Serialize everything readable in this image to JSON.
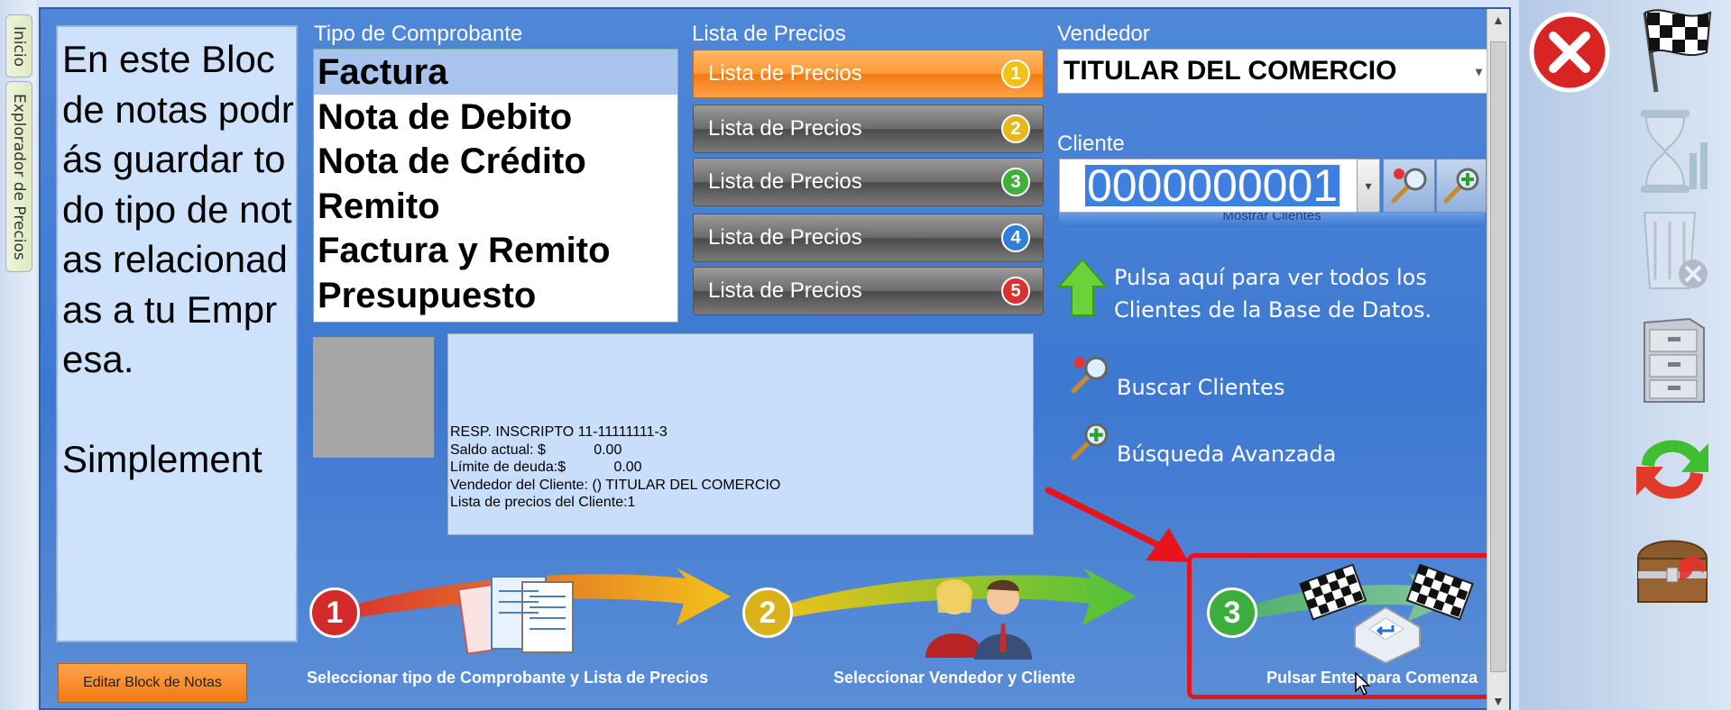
{
  "side_tabs": [
    "Inicio",
    "Explorador de Precios"
  ],
  "notes": {
    "text": "En este Bloc de notas podrás guardar todo tipo de notas relacionadas a tu Empresa.\n\nSimplement",
    "edit_button": "Editar Block de Notas"
  },
  "comprobante": {
    "label": "Tipo de Comprobante",
    "items": [
      "Factura",
      "Nota de Debito",
      "Nota de Crédito",
      "Remito",
      "Factura y Remito",
      "Presupuesto"
    ],
    "selected": "Factura"
  },
  "precios": {
    "label": "Lista de Precios",
    "items": [
      {
        "label": "Lista de Precios",
        "num": "1",
        "color": "#f2c21a"
      },
      {
        "label": "Lista de Precios",
        "num": "2",
        "color": "#e6b81c"
      },
      {
        "label": "Lista de Precios",
        "num": "3",
        "color": "#3fb03a"
      },
      {
        "label": "Lista de Precios",
        "num": "4",
        "color": "#2e7fd6"
      },
      {
        "label": "Lista de Precios",
        "num": "5",
        "color": "#d93030"
      }
    ],
    "selected": "1"
  },
  "cliente_info": {
    "lines": [
      "RESP. INSCRIPTO 11-11111111-3",
      "Saldo actual: $            0.00",
      "Límite de deuda:$            0.00",
      "Vendedor del Cliente:  () TITULAR DEL COMERCIO",
      "Lista de precios del Cliente:1"
    ]
  },
  "vendedor": {
    "label": "Vendedor",
    "value": "TITULAR DEL COMERCIO"
  },
  "cliente": {
    "label": "Cliente",
    "value": "0000000001",
    "mostrar": "Mostrar Clientes"
  },
  "links": {
    "ver_todos": "Pulsa aquí para ver todos los\nClientes de la Base de Datos.",
    "buscar": "Buscar Clientes",
    "avanzada": "Búsqueda Avanzada"
  },
  "steps": [
    {
      "num": "1",
      "label": "Seleccionar tipo de Comprobante y Lista de Precios",
      "color": "#d32b2b"
    },
    {
      "num": "2",
      "label": "Seleccionar Vendedor y Cliente",
      "color": "#d9b21a"
    },
    {
      "num": "3",
      "label": "Pulsar Enter para Comenza",
      "color": "#3cae3c"
    }
  ],
  "colors": {
    "accent": "#3d78d1",
    "highlight": "#e8141c",
    "selected_price": "#ff9933"
  }
}
